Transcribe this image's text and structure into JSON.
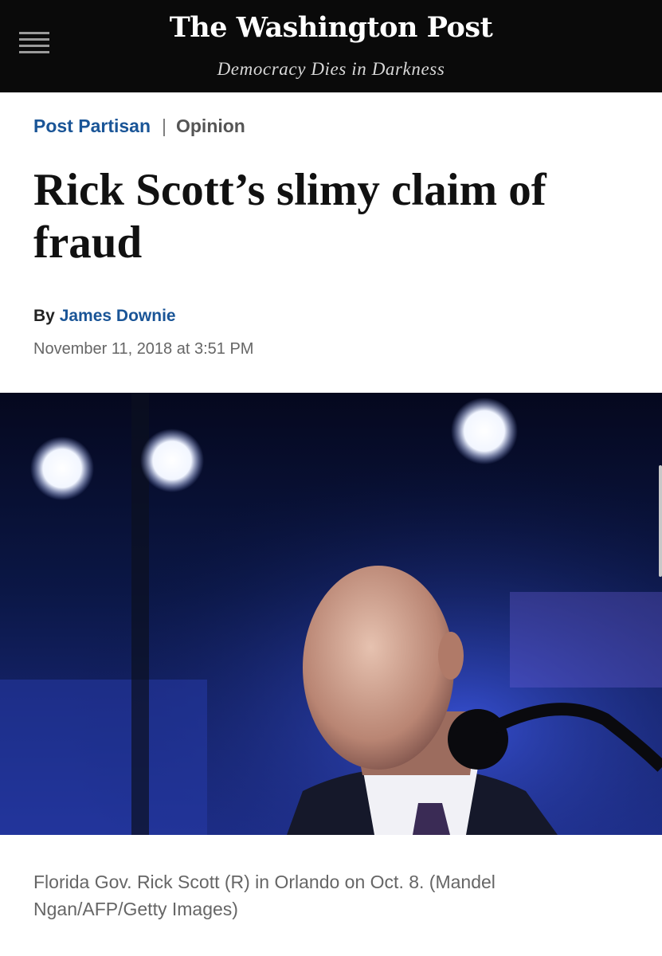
{
  "header": {
    "logo_text": "The Washington Post",
    "tagline": "Democracy Dies in Darkness",
    "menu_icon": "hamburger-menu-icon",
    "background_color": "#0a0a0a"
  },
  "kicker": {
    "section": "Post Partisan",
    "separator": "|",
    "label": "Opinion",
    "section_color": "#1a5597"
  },
  "article": {
    "headline": "Rick Scott’s slimy claim of fraud",
    "byline_prefix": "By",
    "author": "James Downie",
    "date": "November 11, 2018 at 3:51 PM"
  },
  "photo": {
    "caption": "Florida Gov. Rick Scott (R) in Orlando on Oct. 8. (Mandel Ngan/AFP/Getty Images)"
  }
}
